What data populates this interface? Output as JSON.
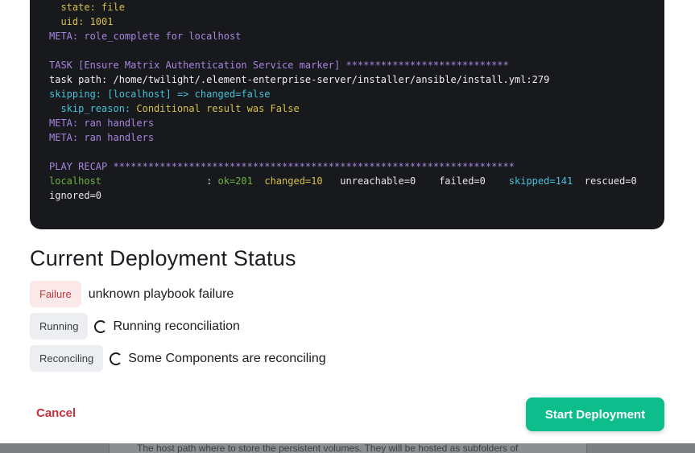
{
  "terminal": {
    "lines": [
      {
        "segments": [
          {
            "t": "  state: file",
            "c": "yellow"
          }
        ]
      },
      {
        "segments": [
          {
            "t": "  uid: 1001",
            "c": "yellow"
          }
        ]
      },
      {
        "segments": [
          {
            "t": "META: role_complete for localhost",
            "c": "purple"
          }
        ]
      },
      {
        "segments": []
      },
      {
        "segments": [
          {
            "t": "TASK [Ensure Matrix Authentication Service marker] ****************************",
            "c": "purple"
          }
        ]
      },
      {
        "segments": [
          {
            "t": "task path: /home/twilight/.element-enterprise-server/installer/ansible/install.yml:279",
            "c": "white"
          }
        ]
      },
      {
        "segments": [
          {
            "t": "skipping: [localhost] => changed=false",
            "c": "cyan"
          }
        ]
      },
      {
        "segments": [
          {
            "t": "  skip_reason: ",
            "c": "cyan"
          },
          {
            "t": "Conditional result was False",
            "c": "yellow"
          }
        ]
      },
      {
        "segments": [
          {
            "t": "META: ran handlers",
            "c": "purple"
          }
        ]
      },
      {
        "segments": [
          {
            "t": "META: ran handlers",
            "c": "purple"
          }
        ]
      },
      {
        "segments": []
      },
      {
        "segments": [
          {
            "t": "PLAY RECAP *********************************************************************",
            "c": "purple"
          }
        ]
      },
      {
        "segments": [
          {
            "t": "localhost",
            "c": "green"
          },
          {
            "t": "                  : ",
            "c": "grey"
          },
          {
            "t": "ok=201",
            "c": "green"
          },
          {
            "t": "  ",
            "c": "grey"
          },
          {
            "t": "changed=10",
            "c": "yellow"
          },
          {
            "t": "   unreachable=0    failed=0    ",
            "c": "grey"
          },
          {
            "t": "skipped=141",
            "c": "cyan"
          },
          {
            "t": "  rescued=0",
            "c": "grey"
          }
        ]
      },
      {
        "segments": [
          {
            "t": "ignored=0",
            "c": "grey"
          }
        ]
      }
    ]
  },
  "page_title": "Current Deployment Status",
  "statuses": [
    {
      "badge": "Failure",
      "text": "unknown playbook failure",
      "spinner": false,
      "kind": "failure"
    },
    {
      "badge": "Running",
      "text": "Running reconciliation",
      "spinner": true,
      "kind": "neutral"
    },
    {
      "badge": "Reconciling",
      "text": "Some Components are reconciling",
      "spinner": true,
      "kind": "neutral"
    }
  ],
  "footer": {
    "cancel_label": "Cancel",
    "start_label": "Start Deployment"
  },
  "backdrop": {
    "text": "The host path where to store the persistent volumes. They will be hosted as subfolders of"
  },
  "colors": {
    "accent": "#0dbd8b",
    "danger": "#c4303c",
    "terminal_bg": "#17191c"
  }
}
